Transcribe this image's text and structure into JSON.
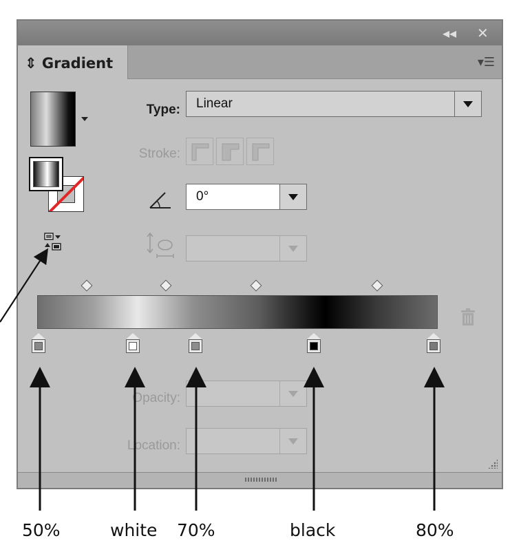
{
  "panel": {
    "title_controls": {
      "collapse": "◂◂",
      "close": "✕"
    },
    "tab_label": "Gradient",
    "tab_prefix_icon": "updown-arrows-icon",
    "menu_icon": "panel-menu-icon"
  },
  "gradient": {
    "type_label": "Type:",
    "type_value": "Linear",
    "stroke_label": "Stroke:",
    "angle_value": "0°",
    "aspect_value": "",
    "opacity_label": "Opacity:",
    "opacity_value": "",
    "location_label": "Location:",
    "location_value": ""
  },
  "annotations": {
    "labels": [
      "50%",
      "white",
      "70%",
      "black",
      "80%"
    ]
  },
  "colors": {
    "panel_bg": "#c1c1c1",
    "titlebar": "#7f7f7f",
    "none_slash": "#e02828"
  }
}
